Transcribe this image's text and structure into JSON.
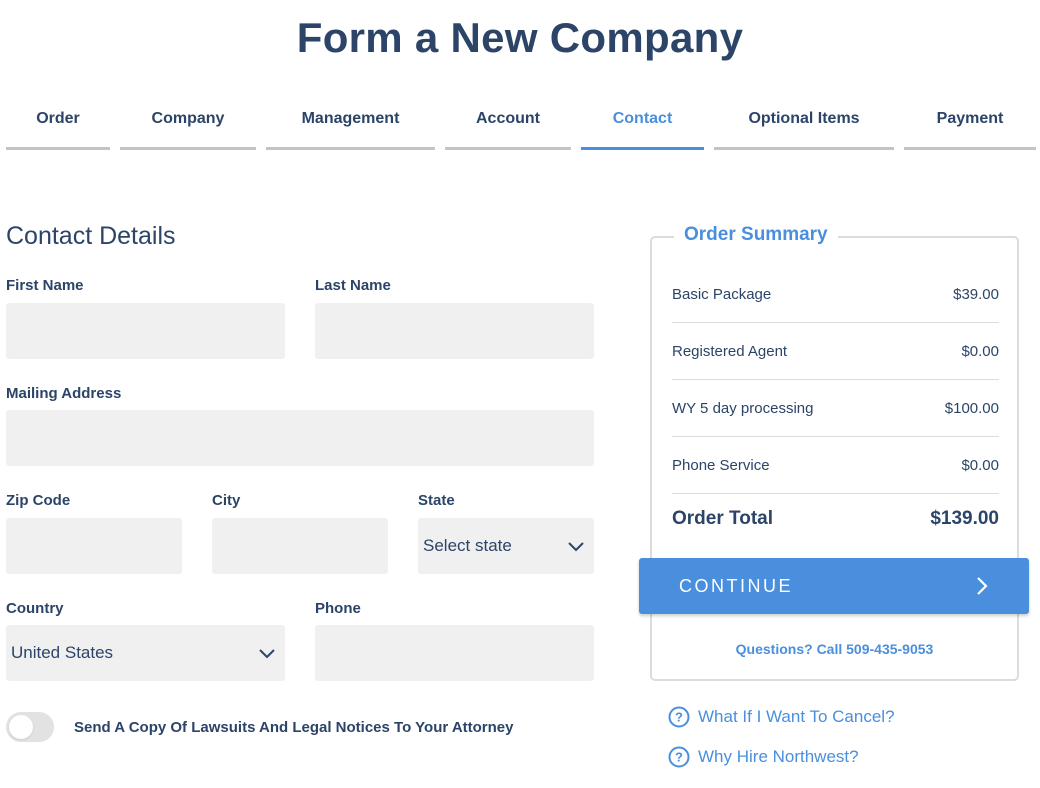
{
  "page": {
    "title": "Form a New Company"
  },
  "tabs": [
    {
      "label": "Order",
      "active": false
    },
    {
      "label": "Company",
      "active": false
    },
    {
      "label": "Management",
      "active": false
    },
    {
      "label": "Account",
      "active": false
    },
    {
      "label": "Contact",
      "active": true
    },
    {
      "label": "Optional Items",
      "active": false
    },
    {
      "label": "Payment",
      "active": false
    }
  ],
  "contact": {
    "section_title": "Contact Details",
    "first_name": {
      "label": "First Name",
      "value": ""
    },
    "last_name": {
      "label": "Last Name",
      "value": ""
    },
    "mailing_address": {
      "label": "Mailing Address",
      "value": ""
    },
    "zip_code": {
      "label": "Zip Code",
      "value": ""
    },
    "city": {
      "label": "City",
      "value": ""
    },
    "state": {
      "label": "State",
      "selected": "Select state"
    },
    "country": {
      "label": "Country",
      "selected": "United States"
    },
    "phone": {
      "label": "Phone",
      "value": ""
    },
    "attorney_toggle": {
      "label": "Send A Copy Of Lawsuits And Legal Notices To Your Attorney",
      "on": false
    }
  },
  "summary": {
    "title": "Order Summary",
    "items": [
      {
        "name": "Basic Package",
        "price": "$39.00"
      },
      {
        "name": "Registered Agent",
        "price": "$0.00"
      },
      {
        "name": "WY 5 day processing",
        "price": "$100.00"
      },
      {
        "name": "Phone Service",
        "price": "$0.00"
      }
    ],
    "total_label": "Order Total",
    "total_value": "$139.00",
    "continue_label": "CONTINUE",
    "questions": "Questions? Call 509-435-9053"
  },
  "help_links": [
    {
      "label": "What If I Want To Cancel?",
      "icon": "question-circle-icon"
    },
    {
      "label": "Why Hire Northwest?",
      "icon": "question-circle-icon"
    }
  ],
  "colors": {
    "primary": "#2b4468",
    "accent": "#4a8fdd",
    "field_bg": "#f0f0f0",
    "tab_inactive": "#c4c4c4"
  }
}
